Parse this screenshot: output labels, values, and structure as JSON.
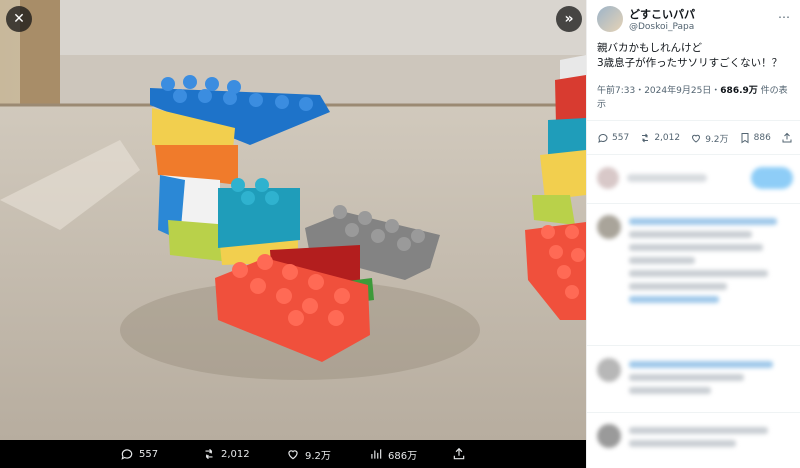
{
  "viewer": {
    "close_icon": "close-icon",
    "expand_icon": "chevrons-right-icon",
    "photo_alt": "",
    "stats": {
      "replies": "557",
      "retweets": "2,012",
      "likes": "9.2万",
      "views": "686万"
    }
  },
  "post": {
    "display_name": "どすこいパパ",
    "handle": "@Doskoi_Papa",
    "text_line1": "親バカかもしれんけど",
    "text_line2": "3歳息子が作ったサソリすごくない！？",
    "timestamp": "午前7:33・2024年9月25日・",
    "views_count": "686.9万",
    "views_label": " 件の表",
    "views_label2": "示",
    "actions": {
      "replies": "557",
      "retweets": "2,012",
      "likes": "9.2万",
      "bookmarks": "886"
    }
  }
}
